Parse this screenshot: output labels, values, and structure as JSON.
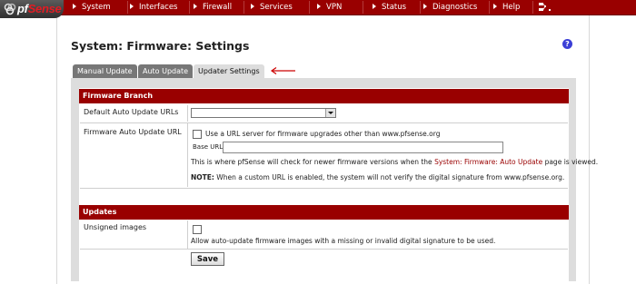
{
  "brand": {
    "logo_text_prefix": "pf",
    "logo_text_main": "Sense"
  },
  "nav": {
    "items": [
      "System",
      "Interfaces",
      "Firewall",
      "Services",
      "VPN",
      "Status",
      "Diagnostics",
      "Help"
    ],
    "color": "#990000"
  },
  "page": {
    "title": "System: Firmware: Settings",
    "help": "?"
  },
  "tabs": [
    {
      "label": "Manual Update",
      "active": false
    },
    {
      "label": "Auto Update",
      "active": false
    },
    {
      "label": "Updater Settings",
      "active": true
    }
  ],
  "firmware_branch": {
    "header": "Firmware Branch",
    "default_urls_label": "Default Auto Update URLs",
    "default_urls_value": "",
    "auto_update_url_label": "Firmware Auto Update URL",
    "checkbox_label": "Use a URL server for firmware upgrades other than www.pfsense.org",
    "checkbox_checked": false,
    "base_url_label": "Base URL:",
    "base_url_value": "",
    "help_prefix": "This is where pfSense will check for newer firmware versions when the",
    "help_link": "System: Firmware: Auto Update",
    "help_suffix": "page is viewed.",
    "note_label": "NOTE:",
    "note_text": "When a custom URL is enabled, the system will not verify the digital signature from www.pfsense.org."
  },
  "updates": {
    "header": "Updates",
    "unsigned_label": "Unsigned images",
    "unsigned_checked": false,
    "unsigned_desc": "Allow auto-update firmware images with a missing or invalid digital signature to be used.",
    "save_label": "Save"
  }
}
